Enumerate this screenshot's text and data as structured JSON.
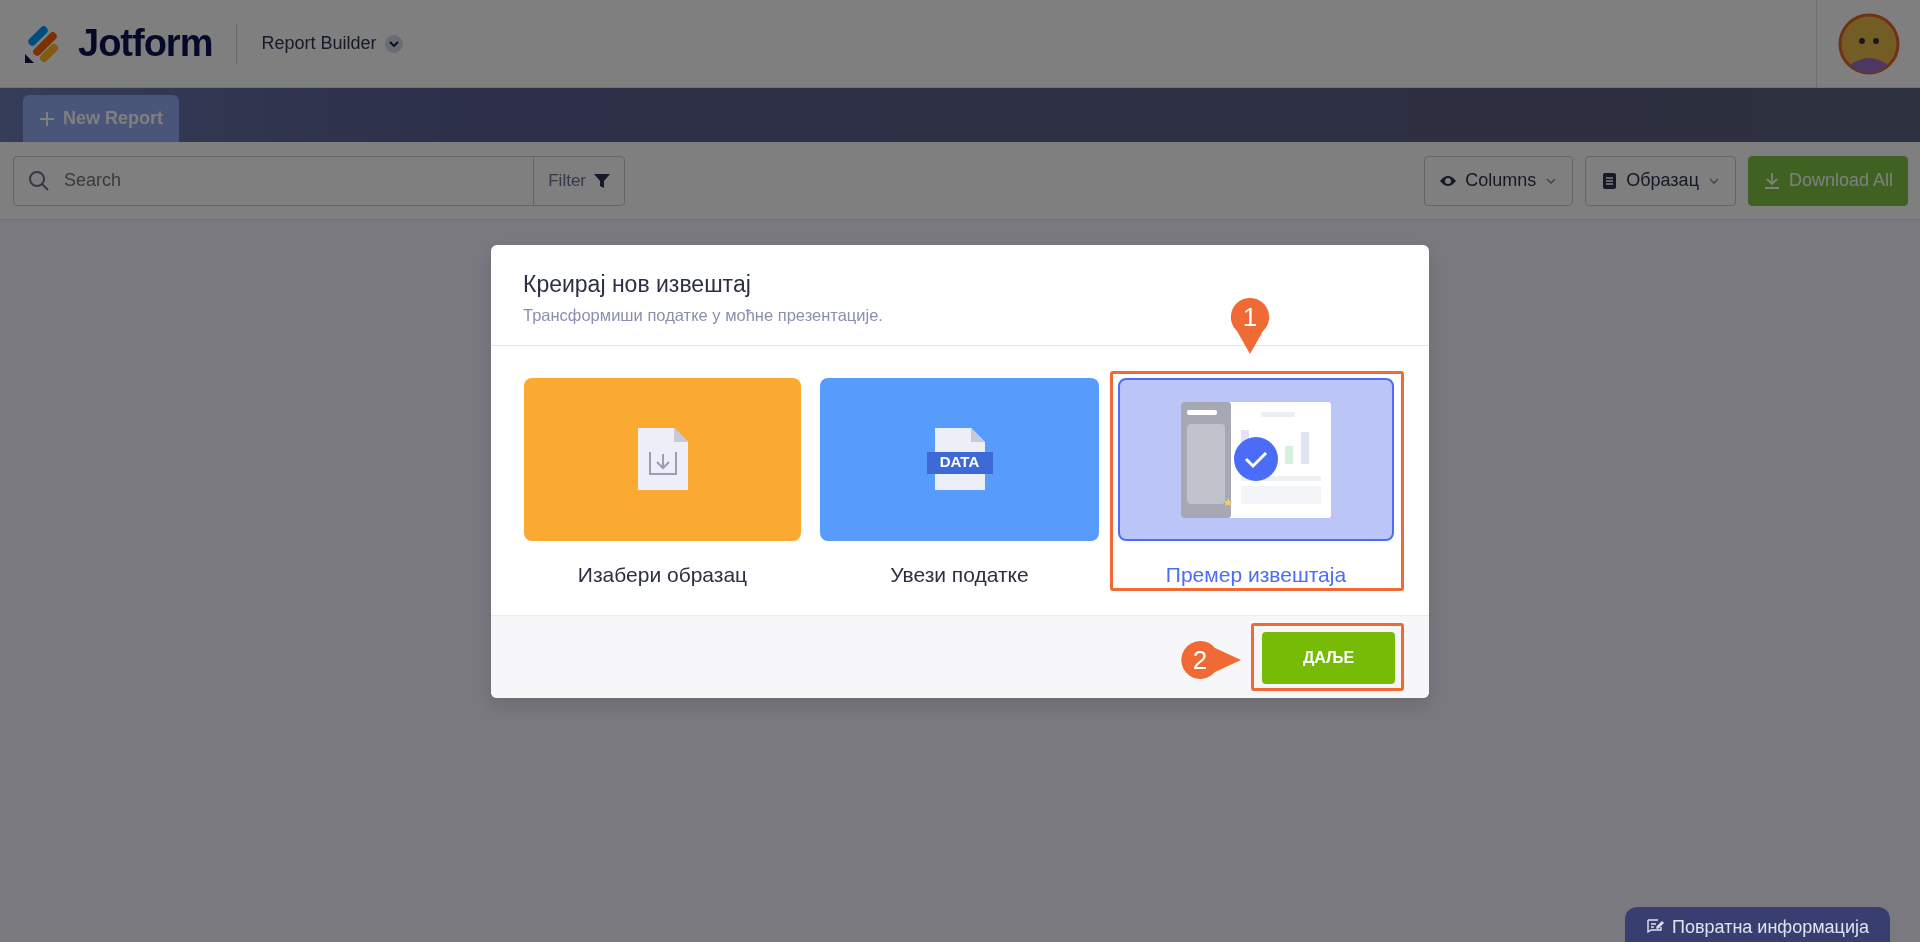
{
  "header": {
    "logo_text": "Jotform",
    "app_menu": "Report Builder"
  },
  "tabs": [
    {
      "label": "New Report",
      "selected": true
    }
  ],
  "toolbar": {
    "search": {
      "placeholder": "Search"
    },
    "filter": "Filter",
    "buttons": [
      {
        "kind": "columns",
        "label": "Columns"
      },
      {
        "kind": "template",
        "label": "Образац"
      },
      {
        "kind": "download",
        "label": "Download All"
      }
    ]
  },
  "modal": {
    "title": "Креирај нов извештај",
    "subtitle": "Трансформиши податке у моћне презентације.",
    "options": [
      {
        "kind": "template",
        "label": "Изабери образац",
        "selected": false
      },
      {
        "kind": "import",
        "label": "Увези податке",
        "badge": "DATA",
        "selected": false
      },
      {
        "kind": "sample",
        "label": "Премер извештаја",
        "selected": true
      }
    ],
    "next_button": "ДАЉЕ"
  },
  "annotations": [
    {
      "label": "1",
      "kind": "down"
    },
    {
      "label": "2",
      "kind": "right"
    }
  ],
  "feedback_button": "Повратна информација"
}
